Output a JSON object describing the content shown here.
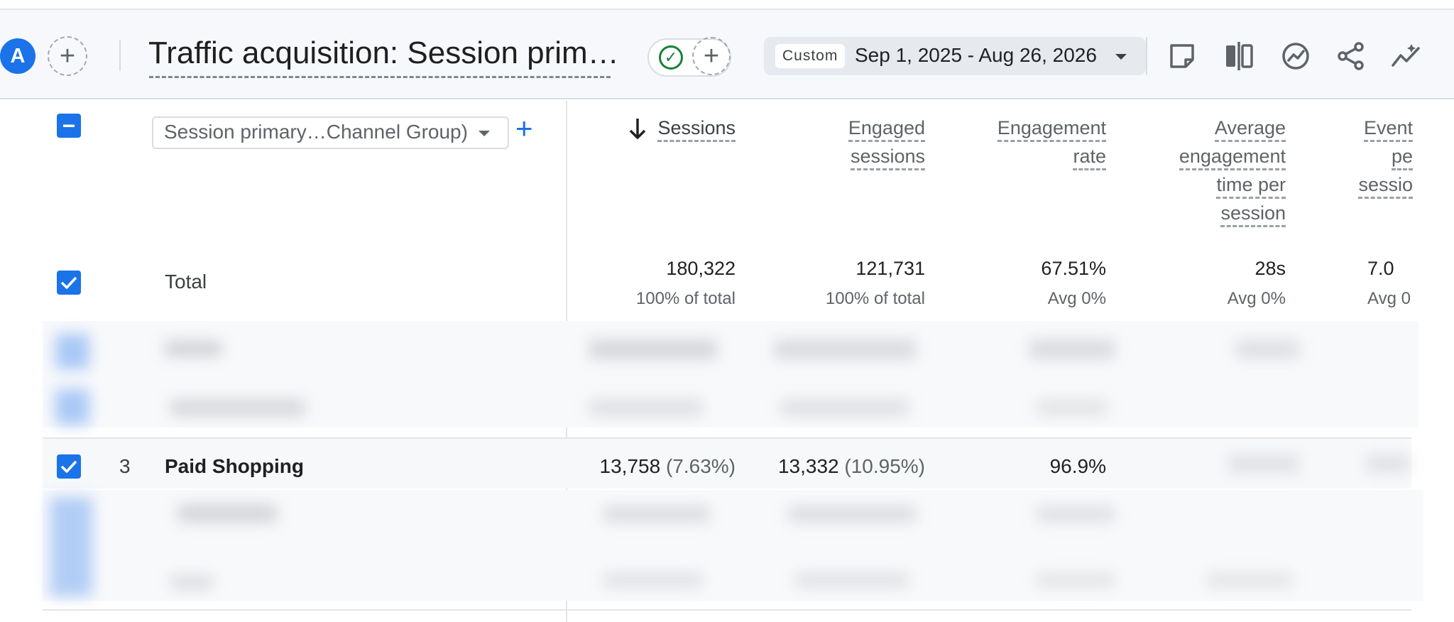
{
  "header": {
    "avatar_letter": "A",
    "report_title": "Traffic acquisition: Session primar…",
    "date_badge": "Custom",
    "date_range": "Sep 1, 2025 - Aug 26, 2026",
    "icons": [
      "customize-report-icon",
      "compare-icon",
      "insights-icon",
      "share-icon",
      "trend-icon"
    ]
  },
  "table": {
    "dimension_selector": "Session primary…Channel Group)",
    "columns": [
      {
        "lines": [
          "Sessions"
        ],
        "sorted": true,
        "sort_direction": "descending"
      },
      {
        "lines": [
          "Engaged",
          "sessions"
        ]
      },
      {
        "lines": [
          "Engagement",
          "rate"
        ]
      },
      {
        "lines": [
          "Average",
          "engagement",
          "time per",
          "session"
        ]
      },
      {
        "lines": [
          "Event",
          "pe",
          "sessio"
        ]
      }
    ],
    "total": {
      "label": "Total",
      "values": [
        "180,322",
        "121,731",
        "67.51%",
        "28s",
        "7.0"
      ],
      "subs": [
        "100% of total",
        "100% of total",
        "Avg 0%",
        "Avg 0%",
        "Avg 0"
      ]
    },
    "rows": [
      {
        "rank": "3",
        "label": "Paid Shopping",
        "sessions": "13,758",
        "sessions_pct": "(7.63%)",
        "engaged": "13,332",
        "engaged_pct": "(10.95%)",
        "engagement_rate": "96.9%"
      }
    ]
  },
  "colors": {
    "accent": "#1a73e8",
    "success": "#188038",
    "header_bg": "#f6f8fb"
  }
}
